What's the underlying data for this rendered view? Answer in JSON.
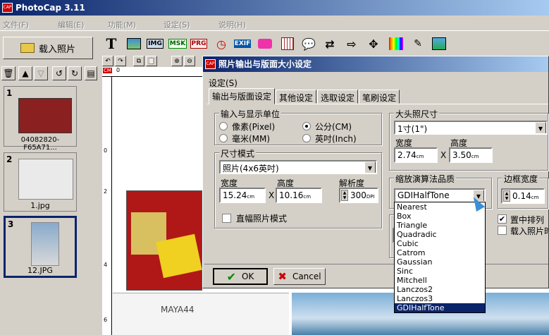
{
  "app": {
    "title": "PhotoCap 3.11"
  },
  "menus": [
    "文件(F)",
    "编辑(E)",
    "功能(M)",
    "设定(S)",
    "说明(H)"
  ],
  "load_button": "载入照片",
  "toolbar_icons": [
    "text-icon",
    "image-icon",
    "img-icon",
    "msk-icon",
    "prg-icon",
    "clock-icon",
    "exif-icon",
    "cake-icon",
    "calendar-icon",
    "speech-icon",
    "arrows-icon",
    "arrow-right-icon",
    "move-icon",
    "palette-icon",
    "edit-icon",
    "landscape-icon"
  ],
  "toolbar_labels": {
    "img": "IMG",
    "msk": "MSK",
    "prg": "PRG",
    "exif": "EXIF",
    "text": "T"
  },
  "thumbnails": [
    {
      "num": "1",
      "caption": "04082820-F65A71..."
    },
    {
      "num": "2",
      "caption": "1.jpg"
    },
    {
      "num": "3",
      "caption": "12.JPG"
    }
  ],
  "ruler_units": "CM",
  "dialog": {
    "title": "照片输出与版面大小设定",
    "settings_label": "设定(S)",
    "tabs": [
      "输出与版面设定",
      "其他设定",
      "选取设定",
      "笔刷设定"
    ],
    "units_group": "输入与显示单位",
    "units": [
      "像素(Pixel)",
      "公分(CM)",
      "毫米(MM)",
      "英吋(Inch)"
    ],
    "size_group": "尺寸模式",
    "size_value": "照片(4x6英吋)",
    "width_label": "宽度",
    "height_label": "高度",
    "resolution_label": "解析度",
    "width_value": "15.24",
    "height_value": "10.16",
    "resolution_value": "300",
    "unit_cm": "cm",
    "unit_dpi": "DPI",
    "portrait_mode": "直幅照片模式",
    "headshot_group": "大头照尺寸",
    "headshot_value": "1寸(1\")",
    "headshot_width": "2.74",
    "headshot_height": "3.50",
    "scale_group": "缩放演算法品质",
    "scale_value": "GDIHalfTone",
    "border_group": "边框宽度",
    "border_value": "0.14",
    "center_arrange": "置中排列",
    "load_photo_time": "载入照片时",
    "ok": "OK",
    "cancel": "Cancel",
    "times": "X"
  },
  "scale_options": [
    "Nearest",
    "Box",
    "Triangle",
    "Quadradic",
    "Cubic",
    "Catrom",
    "Gaussian",
    "Sinc",
    "Mitchell",
    "Lanczos2",
    "Lanczos3",
    "GDIHalfTone"
  ],
  "selected_option": "GDIHalfTone",
  "photo_text": {
    "maya": "MAYA44"
  }
}
